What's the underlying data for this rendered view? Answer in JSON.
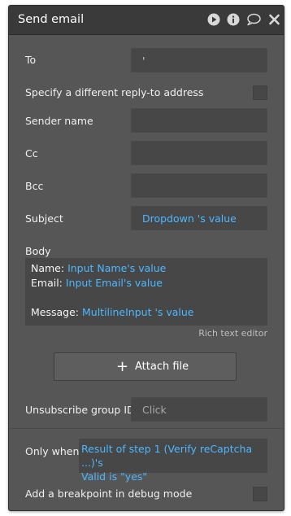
{
  "header": {
    "title": "Send email",
    "icons": [
      "play-icon",
      "info-icon",
      "comment-icon",
      "close-icon"
    ]
  },
  "fields": {
    "to_label": "To",
    "to_value": "'",
    "reply_to_label": "Specify a different reply-to address",
    "sender_label": "Sender name",
    "cc_label": "Cc",
    "bcc_label": "Bcc",
    "subject_label": "Subject",
    "subject_value": "Dropdown 's value"
  },
  "body": {
    "label": "Body",
    "lines": [
      {
        "prefix": "Name: ",
        "value": "Input Name's value"
      },
      {
        "prefix": "Email: ",
        "value": "Input Email's value"
      },
      {
        "prefix": "Message: ",
        "value": "MultilineInput 's value"
      }
    ],
    "hint": "Rich text editor"
  },
  "attach": {
    "label": "Attach file"
  },
  "unsubscribe": {
    "label": "Unsubscribe group ID",
    "placeholder": "Click"
  },
  "condition": {
    "label": "Only when",
    "value_line1": "Result of step 1 (Verify reCaptcha ...)'s",
    "value_line2": "Valid is \"yes\""
  },
  "breakpoint": {
    "label": "Add a breakpoint in debug mode"
  },
  "colors": {
    "panel": "#565656",
    "header": "#3a3a3a",
    "field": "#474747",
    "dynamic_text": "#4db7ff"
  }
}
